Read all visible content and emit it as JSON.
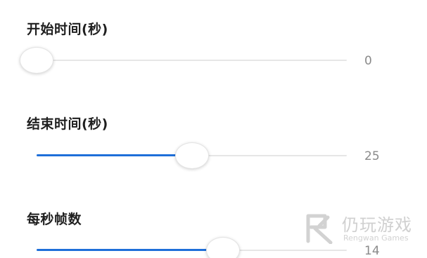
{
  "settings": {
    "start": {
      "label": "开始时间(秒)",
      "value": "0",
      "fraction": 0.0
    },
    "end": {
      "label": "结束时间(秒)",
      "value": "25",
      "fraction": 0.5
    },
    "fps": {
      "label": "每秒帧数",
      "value": "14",
      "fraction": 0.6
    }
  },
  "watermark": {
    "title": "仍玩游戏",
    "subtitle": "Rengwan Games"
  },
  "colors": {
    "accent": "#1e6fd9",
    "track": "#e6e6e6",
    "value_text": "#8a8a8a"
  }
}
